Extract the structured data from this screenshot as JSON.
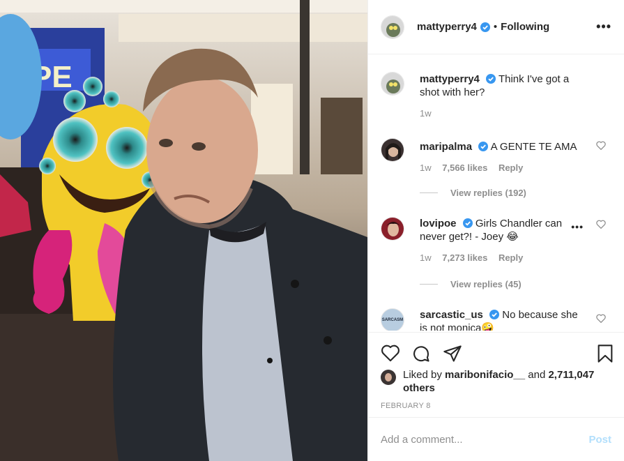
{
  "post": {
    "author": "mattyperry4",
    "separator": "•",
    "follow_status": "Following",
    "more_label": "•••"
  },
  "caption": {
    "username": "mattyperry4",
    "text": "Think I've got a shot with her?",
    "time": "1w"
  },
  "comments": [
    {
      "username": "maripalma",
      "text": "A GENTE TE AMA",
      "time": "1w",
      "likes": "7,566 likes",
      "reply": "Reply",
      "view_replies": "View replies (192)"
    },
    {
      "username": "lovipoe",
      "text": "Girls Chandler can never get?! - Joey 😂",
      "time": "1w",
      "likes": "7,273 likes",
      "reply": "Reply",
      "view_replies": "View replies (45)",
      "more_label": "•••"
    },
    {
      "username": "sarcastic_us",
      "text": "No because she is not monica🤪",
      "avatar_text": "SARCASM"
    }
  ],
  "liked_by": {
    "prefix": "Liked by",
    "user": "maribonifacio__",
    "and": "and",
    "others": "2,711,047 others"
  },
  "date": "FEBRUARY 8",
  "composer": {
    "placeholder": "Add a comment...",
    "post_label": "Post"
  },
  "colors": {
    "verified": "#3897f0",
    "post_disabled": "#b2dffc",
    "muted": "#8e8e8e"
  },
  "icons": [
    "heart-icon",
    "comment-icon",
    "share-icon",
    "bookmark-icon",
    "verified-icon",
    "more-icon"
  ]
}
